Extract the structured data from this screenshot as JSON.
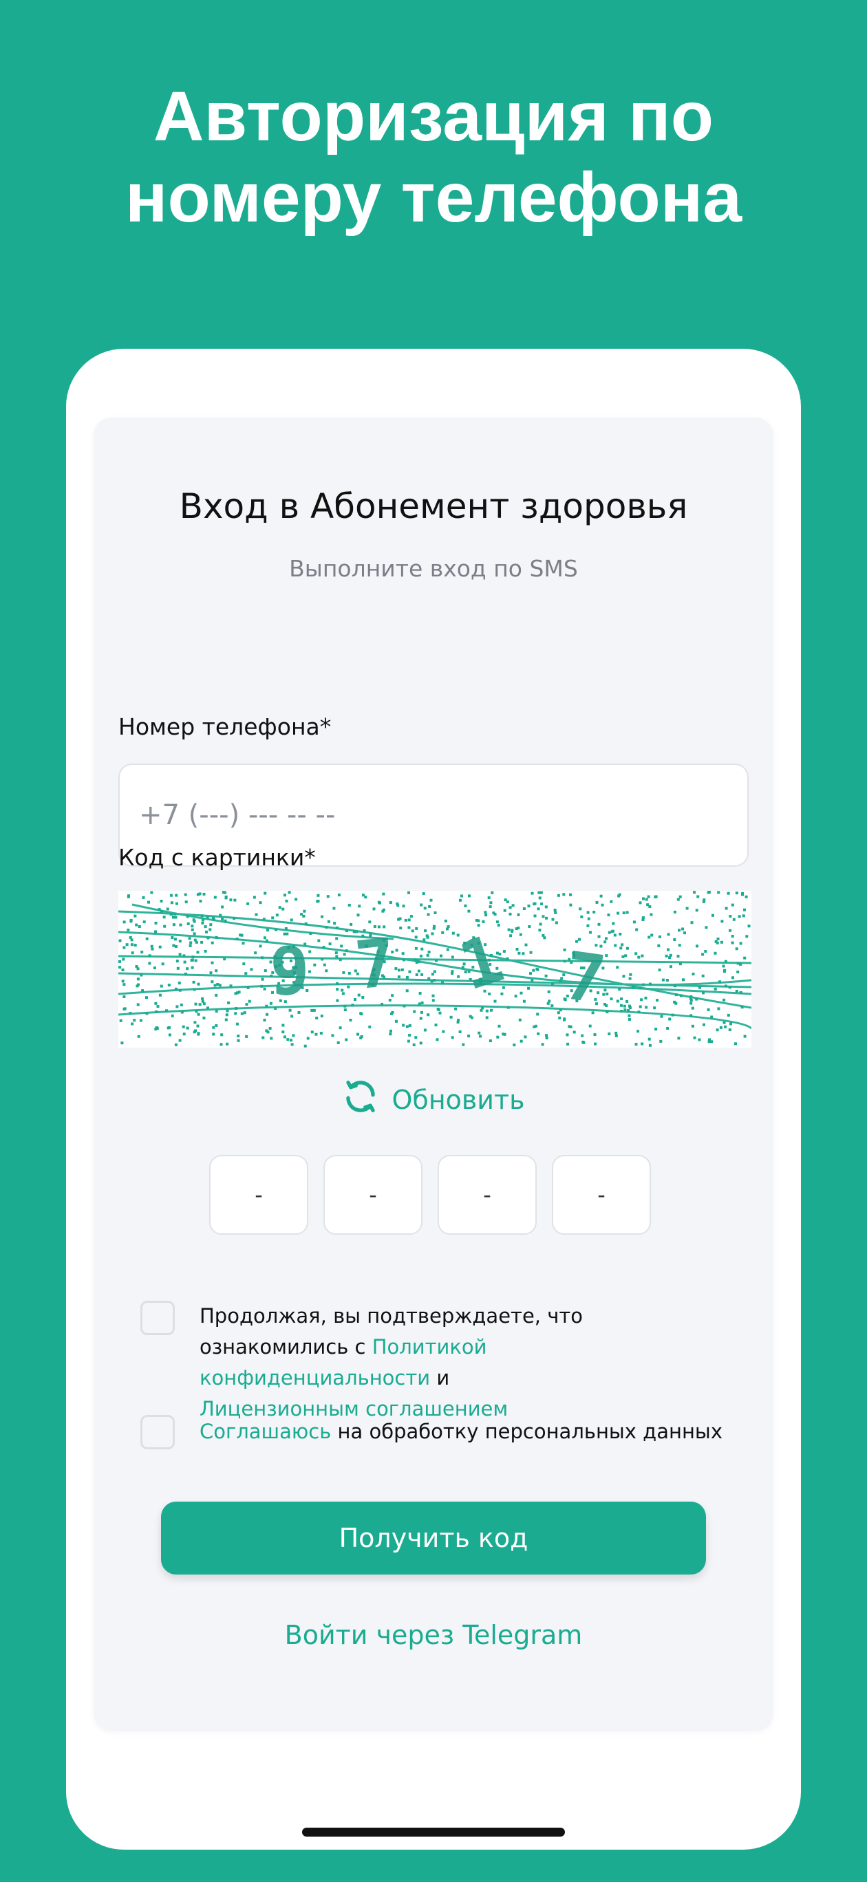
{
  "hero": {
    "line1": "Авторизация по",
    "line2": "номеру телефона"
  },
  "card": {
    "title": "Вход в Абонемент здоровья",
    "subtitle": "Выполните вход по SMS"
  },
  "phone_field": {
    "label": "Номер телефона*",
    "placeholder": "+7 (---) --- -- --",
    "value": ""
  },
  "captcha": {
    "label": "Код с картинки*",
    "digits_drawn": "9 7 1 7",
    "refresh_label": "Обновить",
    "refresh_icon": "refresh-icon"
  },
  "code_boxes": [
    "-",
    "-",
    "-",
    "-"
  ],
  "consent": {
    "prefix": "Продолжая, вы подтверждаете, что ознакомились с",
    "privacy_link": "Политикой конфиденциальности",
    "and": "и",
    "license_link": "Лицензионным соглашением",
    "checked": false
  },
  "personal_data": {
    "link": "Соглашаюсь",
    "text": "на обработку персональных данных",
    "checked": false
  },
  "buttons": {
    "get_code": "Получить код",
    "telegram": "Войти через Telegram"
  },
  "colors": {
    "brand": "#1aab91",
    "card_bg": "#f4f5f8",
    "text": "#111111",
    "muted": "#7a7f88"
  }
}
